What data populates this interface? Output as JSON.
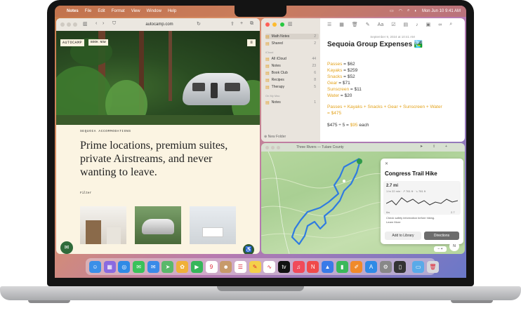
{
  "menubar": {
    "apple_icon": "apple-icon",
    "items": [
      "Notes",
      "File",
      "Edit",
      "Format",
      "View",
      "Window",
      "Help"
    ],
    "clock": "Mon Jun 10 9:41 AM"
  },
  "safari": {
    "url": "autocamp.com",
    "brand": "AUTOCAMP",
    "book_label": "BOOK NOW",
    "kicker": "SEQUOIA ACCOMMODATIONS",
    "headline": "Prime locations, premium suites, private Airstreams, and never wanting to leave.",
    "filter_label": "Filter"
  },
  "notes": {
    "sidebar": {
      "top": [
        {
          "label": "Math Notes",
          "count": "2"
        },
        {
          "label": "Shared",
          "count": "2"
        }
      ],
      "icloud_header": "iCloud",
      "icloud": [
        {
          "label": "All iCloud",
          "count": "44"
        },
        {
          "label": "Notes",
          "count": "23"
        },
        {
          "label": "Book Club",
          "count": "6"
        },
        {
          "label": "Recipes",
          "count": "8"
        },
        {
          "label": "Therapy",
          "count": "5"
        }
      ],
      "mac_header": "On My Mac",
      "mac": [
        {
          "label": "Notes",
          "count": "1"
        }
      ],
      "new_folder": "New Folder"
    },
    "date": "September 9, 2024 at 10:41 AM",
    "title": "Sequoia Group Expenses 🏞️",
    "lines": [
      {
        "k": "Passes",
        "v": " = $62"
      },
      {
        "k": "Kayaks",
        "v": " = $259"
      },
      {
        "k": "Snacks",
        "v": " = $52"
      },
      {
        "k": "Gear",
        "v": " = $71"
      },
      {
        "k": "Sunscreen",
        "v": " = $11"
      },
      {
        "k": "Water",
        "v": " = $20"
      }
    ],
    "sum_line": "Passes + Kayaks + Snacks + Gear + Sunscreen + Water",
    "sum_result": "= $475",
    "split_expr": "$475 ÷ 5 = ",
    "split_result": "$95",
    "split_suffix": " each"
  },
  "maps": {
    "window_title": "Three Rivers — Tulare County",
    "card": {
      "title": "Congress Trail Hike",
      "distance": "2.7 mi",
      "details": "1 hr 22 min · ↗ 761 ft · ↘ 781 ft",
      "elev_start": "6w",
      "elev_end": "2.7",
      "note": "Check safety information before hiking.",
      "learn_more": "Learn More",
      "add_label": "Add to Library",
      "directions_label": "Directions"
    },
    "compass": "N"
  },
  "dock": {
    "apps": [
      {
        "name": "finder-icon",
        "color": "#3a8fe8",
        "glyph": "☺"
      },
      {
        "name": "launchpad-icon",
        "color": "#8a6ae0",
        "glyph": "▦"
      },
      {
        "name": "safari-icon",
        "color": "#2f8ae6",
        "glyph": "◎"
      },
      {
        "name": "messages-icon",
        "color": "#3ac25a",
        "glyph": "✉"
      },
      {
        "name": "mail-icon",
        "color": "#3a8ae8",
        "glyph": "✉"
      },
      {
        "name": "maps-icon",
        "color": "#5ab86a",
        "glyph": "➤"
      },
      {
        "name": "photos-icon",
        "color": "#f0b03a",
        "glyph": "✿"
      },
      {
        "name": "facetime-icon",
        "color": "#36b65a",
        "glyph": "▶"
      },
      {
        "name": "calendar-icon",
        "color": "#ffffff",
        "glyph": "9"
      },
      {
        "name": "contacts-icon",
        "color": "#c79a6a",
        "glyph": "☻"
      },
      {
        "name": "reminders-icon",
        "color": "#ffffff",
        "glyph": "☰"
      },
      {
        "name": "notes-icon",
        "color": "#f4d04a",
        "glyph": "✎"
      },
      {
        "name": "freeform-icon",
        "color": "#ffffff",
        "glyph": "∿"
      },
      {
        "name": "tv-icon",
        "color": "#111111",
        "glyph": "tv"
      },
      {
        "name": "music-icon",
        "color": "#f04a5a",
        "glyph": "♫"
      },
      {
        "name": "news-icon",
        "color": "#f04a4a",
        "glyph": "N"
      },
      {
        "name": "keynote-icon",
        "color": "#3a7ae8",
        "glyph": "▲"
      },
      {
        "name": "numbers-icon",
        "color": "#3ab85a",
        "glyph": "▮"
      },
      {
        "name": "pages-icon",
        "color": "#f08a2a",
        "glyph": "✐"
      },
      {
        "name": "app-store-icon",
        "color": "#2f8ae6",
        "glyph": "A"
      },
      {
        "name": "settings-icon",
        "color": "#888888",
        "glyph": "⚙"
      },
      {
        "name": "iphone-mirroring-icon",
        "color": "#333333",
        "glyph": "▯"
      },
      {
        "name": "downloads-folder-icon",
        "color": "#5aaae8",
        "glyph": "▭"
      },
      {
        "name": "trash-icon",
        "color": "#d8d8dc",
        "glyph": "🗑"
      }
    ]
  }
}
